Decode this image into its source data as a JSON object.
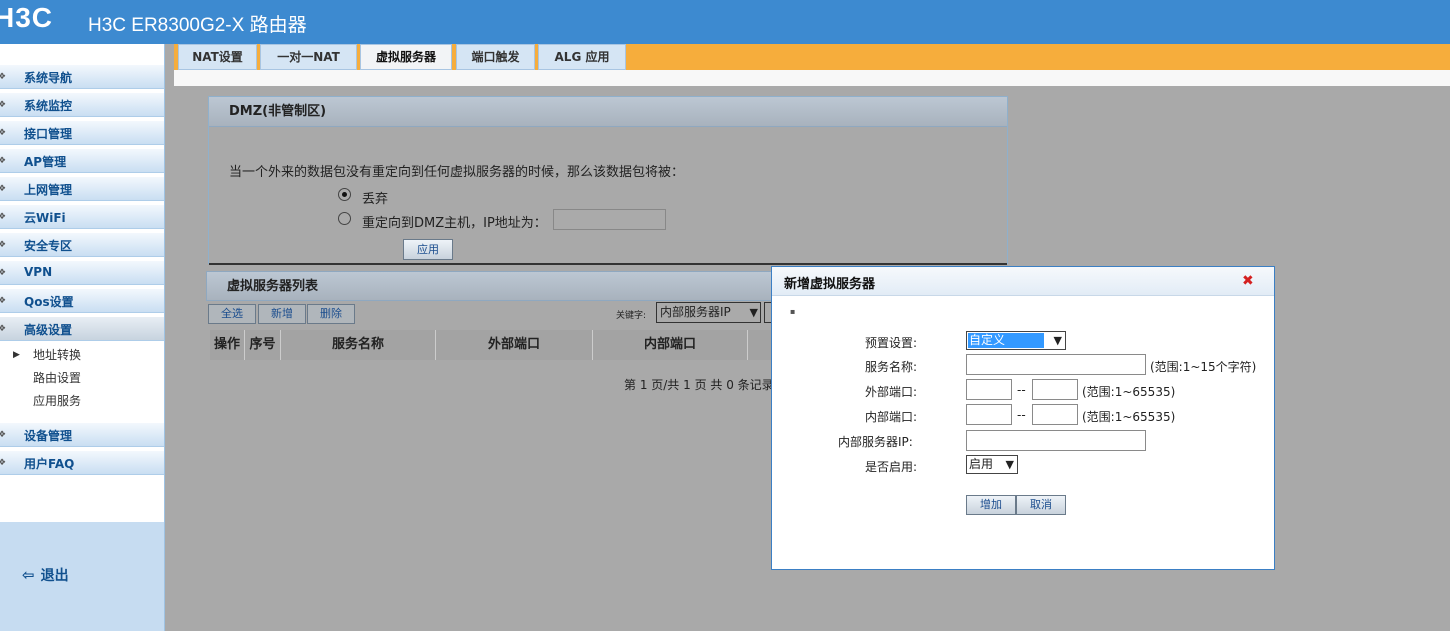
{
  "header": {
    "logo": "H3C",
    "product": "H3C ER8300G2-X 路由器"
  },
  "sidebar": {
    "items": [
      {
        "label": "系统导航"
      },
      {
        "label": "系统监控"
      },
      {
        "label": "接口管理"
      },
      {
        "label": "AP管理"
      },
      {
        "label": "上网管理"
      },
      {
        "label": "云WiFi"
      },
      {
        "label": "安全专区"
      },
      {
        "label": "VPN"
      },
      {
        "label": "Qos设置"
      },
      {
        "label": "高级设置"
      }
    ],
    "subitems": [
      {
        "label": "地址转换"
      },
      {
        "label": "路由设置"
      },
      {
        "label": "应用服务"
      }
    ],
    "after": [
      {
        "label": "设备管理"
      },
      {
        "label": "用户FAQ"
      }
    ],
    "logout": "退出"
  },
  "tabs": [
    {
      "label": "NAT设置"
    },
    {
      "label": "一对一NAT"
    },
    {
      "label": "虚拟服务器"
    },
    {
      "label": "端口触发"
    },
    {
      "label": "ALG 应用"
    }
  ],
  "dmz": {
    "title": "DMZ(非管制区)",
    "description": "当一个外来的数据包没有重定向到任何虚拟服务器的时候，那么该数据包将被：",
    "option_drop": "丢弃",
    "option_redirect": "重定向到DMZ主机，IP地址为：",
    "ip_value": "",
    "apply": "应用"
  },
  "vs_list": {
    "title": "虚拟服务器列表",
    "select_all": "全选",
    "add": "新增",
    "delete": "删除",
    "keyword_label": "关键字:",
    "keyword_select": "内部服务器IP",
    "columns": [
      "操作",
      "序号",
      "服务名称",
      "外部端口",
      "内部端口"
    ],
    "pager": "第 1 页/共 1 页 共 0 条记录"
  },
  "dialog": {
    "title": "新增虚拟服务器",
    "close": "✖",
    "preset_label": "预置设置:",
    "preset_value": "自定义",
    "name_label": "服务名称:",
    "name_hint": "(范围:1~15个字符)",
    "ext_port_label": "外部端口:",
    "int_port_label": "内部端口:",
    "port_hint": "(范围:1~65535)",
    "dash": "--",
    "server_ip_label": "内部服务器IP:",
    "enable_label": "是否启用:",
    "enable_value": "启用",
    "add_button": "增加",
    "cancel_button": "取消"
  }
}
